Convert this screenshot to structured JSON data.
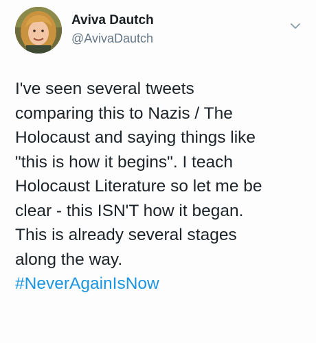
{
  "author": {
    "display_name": "Aviva Dautch",
    "handle": "@AvivaDautch",
    "avatar_icon": "profile-photo",
    "menu_icon": "chevron-down-icon"
  },
  "tweet": {
    "lines": [
      "I've seen several tweets",
      "comparing this to Nazis / The",
      "Holocaust and saying things like",
      "\"this is how it begins\". I teach",
      "Holocaust Literature so let me be",
      "clear - this ISN'T how it began.",
      "This is already several stages",
      "along the way."
    ],
    "hashtag": "#NeverAgainIsNow"
  },
  "colors": {
    "hashtag": "#1b95e0",
    "handle": "#657786",
    "text": "#1c2329"
  }
}
